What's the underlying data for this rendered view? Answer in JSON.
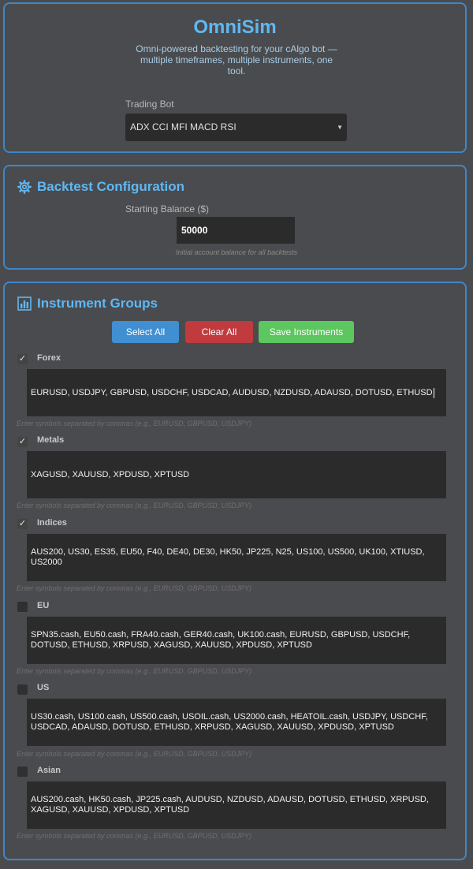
{
  "app": {
    "title": "OmniSim",
    "subtitle": "Omni-powered backtesting for your cAlgo bot — multiple timeframes, multiple instruments, one tool."
  },
  "bot": {
    "label": "Trading Bot",
    "selected": "ADX CCI MFI MACD RSI"
  },
  "config": {
    "title": "Backtest Configuration",
    "balance_label": "Starting Balance ($)",
    "balance_value": "50000",
    "balance_hint": "Initial account balance for all backtests"
  },
  "groups_section": {
    "title": "Instrument Groups",
    "select_all": "Select All",
    "clear_all": "Clear All",
    "save": "Save Instruments",
    "hint": "Enter symbols separated by commas (e.g., EURUSD, GBPUSD, USDJPY)"
  },
  "groups": [
    {
      "name": "Forex",
      "checked": true,
      "symbols": "EURUSD, USDJPY, GBPUSD, USDCHF, USDCAD, AUDUSD, NZDUSD, ADAUSD, DOTUSD, ETHUSD"
    },
    {
      "name": "Metals",
      "checked": true,
      "symbols": "XAGUSD, XAUUSD, XPDUSD, XPTUSD"
    },
    {
      "name": "Indices",
      "checked": true,
      "symbols": "AUS200, US30, ES35, EU50, F40, DE40, DE30, HK50, JP225, N25, US100, US500, UK100, XTIUSD, US2000"
    },
    {
      "name": "EU",
      "checked": false,
      "symbols": "SPN35.cash, EU50.cash, FRA40.cash, GER40.cash, UK100.cash, EURUSD, GBPUSD, USDCHF, DOTUSD, ETHUSD, XRPUSD, XAGUSD, XAUUSD, XPDUSD, XPTUSD"
    },
    {
      "name": "US",
      "checked": false,
      "symbols": "US30.cash, US100.cash, US500.cash, USOIL.cash, US2000.cash, HEATOIL.cash, USDJPY, USDCHF, USDCAD, ADAUSD, DOTUSD, ETHUSD, XRPUSD, XAGUSD, XAUUSD, XPDUSD, XPTUSD"
    },
    {
      "name": "Asian",
      "checked": false,
      "symbols": "AUS200.cash, HK50.cash, JP225.cash, AUDUSD, NZDUSD, ADAUSD, DOTUSD, ETHUSD, XRPUSD, XAGUSD, XAUUSD, XPDUSD, XPTUSD"
    }
  ],
  "colors": {
    "accent": "#5fb8f3",
    "panel_border": "#3f86c8",
    "select_all": "#3f8fd2",
    "clear_all": "#c03a3e",
    "save": "#5cc65f"
  }
}
